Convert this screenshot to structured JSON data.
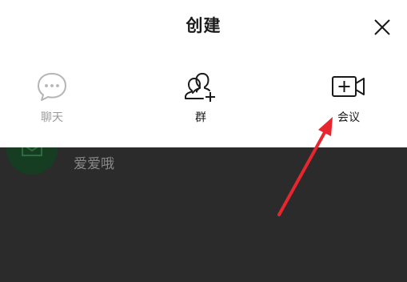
{
  "header": {
    "title": "创建"
  },
  "options": [
    {
      "label": "聊天",
      "icon": "chat-bubble-icon",
      "state": "disabled"
    },
    {
      "label": "群",
      "icon": "group-add-icon",
      "state": "enabled"
    },
    {
      "label": "会议",
      "icon": "video-add-icon",
      "state": "enabled"
    }
  ],
  "background_list": {
    "item_name": "爱爱哦"
  },
  "colors": {
    "annotation_arrow": "#e8262d",
    "overlay": "#2b2b2b",
    "disabled_text": "#9a9a9a",
    "avatar": "#163d21"
  }
}
